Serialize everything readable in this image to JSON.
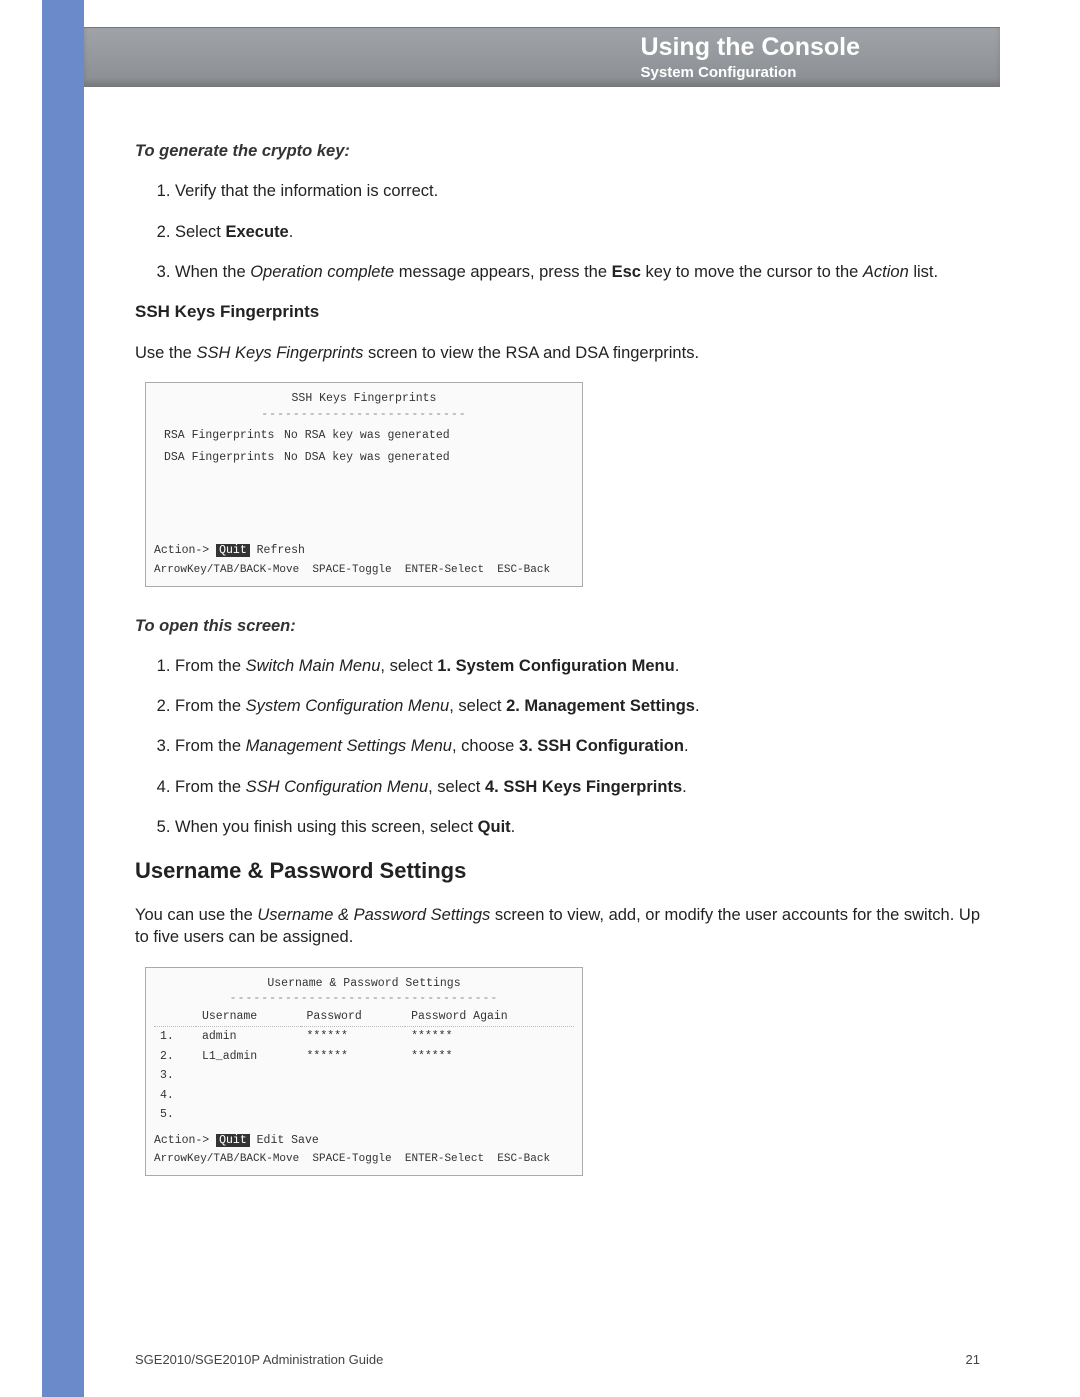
{
  "header": {
    "title": "Using the Console",
    "subtitle": "System Configuration"
  },
  "section1": {
    "lead": "To generate the crypto key:",
    "step1": "Verify that the information is correct.",
    "step2_a": "Select ",
    "step2_b": "Execute",
    "step2_c": ".",
    "step3_a": "When the ",
    "step3_b": "Operation complete",
    "step3_c": " message appears, press the ",
    "step3_d": "Esc",
    "step3_e": " key to move the cursor to the ",
    "step3_f": "Action",
    "step3_g": " list."
  },
  "ssh": {
    "heading": "SSH Keys Fingerprints",
    "desc_a": "Use the ",
    "desc_b": "SSH Keys Fingerprints",
    "desc_c": " screen to view the RSA and DSA fingerprints."
  },
  "shot1": {
    "title": "SSH Keys Fingerprints",
    "rsa_label": "RSA Fingerprints",
    "rsa_value": "No RSA key was generated",
    "dsa_label": "DSA Fingerprints",
    "dsa_value": "No DSA key was generated",
    "action_prefix": "Action->",
    "action_sel": "Quit",
    "action_rest": "  Refresh",
    "status": "ArrowKey/TAB/BACK-Move  SPACE-Toggle  ENTER-Select  ESC-Back"
  },
  "openscreen": {
    "lead": "To open this screen:",
    "s1_a": "From the ",
    "s1_b": "Switch Main Menu",
    "s1_c": ", select ",
    "s1_d": "1. System Configuration Menu",
    "s1_e": ".",
    "s2_a": "From the ",
    "s2_b": "System Configuration Menu",
    "s2_c": ", select ",
    "s2_d": "2. Management Settings",
    "s2_e": ".",
    "s3_a": "From the ",
    "s3_b": "Management Settings Menu",
    "s3_c": ", choose ",
    "s3_d": "3. SSH Configuration",
    "s3_e": ".",
    "s4_a": "From the ",
    "s4_b": "SSH Configuration Menu",
    "s4_c": ", select ",
    "s4_d": "4. SSH Keys Fingerprints",
    "s4_e": ".",
    "s5_a": "When you finish using this screen, select ",
    "s5_b": "Quit",
    "s5_c": "."
  },
  "userpass": {
    "heading": "Username & Password Settings",
    "desc_a": "You can use the ",
    "desc_b": "Username & Password Settings",
    "desc_c": " screen to view, add, or modify the user accounts for the switch. Up to five users can be assigned."
  },
  "shot2": {
    "title": "Username & Password Settings",
    "col1": "Username",
    "col2": "Password",
    "col3": "Password Again",
    "rows": [
      {
        "n": "1.",
        "u": "admin",
        "p": "******",
        "pa": "******"
      },
      {
        "n": "2.",
        "u": "L1_admin",
        "p": "******",
        "pa": "******"
      },
      {
        "n": "3.",
        "u": "",
        "p": "",
        "pa": ""
      },
      {
        "n": "4.",
        "u": "",
        "p": "",
        "pa": ""
      },
      {
        "n": "5.",
        "u": "",
        "p": "",
        "pa": ""
      }
    ],
    "action_prefix": "Action->",
    "action_sel": "Quit",
    "action_rest": "  Edit   Save",
    "status": "ArrowKey/TAB/BACK-Move  SPACE-Toggle  ENTER-Select  ESC-Back"
  },
  "footer": {
    "left": "SGE2010/SGE2010P Administration Guide",
    "right": "21"
  }
}
